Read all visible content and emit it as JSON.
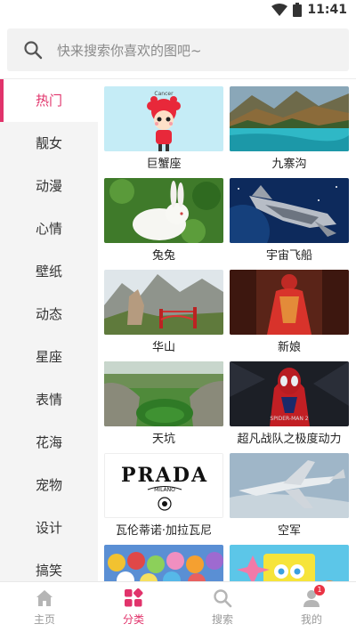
{
  "status_bar": {
    "time": "11:41"
  },
  "search": {
    "placeholder": "快来搜索你喜欢的图吧~"
  },
  "sidebar": {
    "items": [
      {
        "label": "热门",
        "active": true
      },
      {
        "label": "靓女"
      },
      {
        "label": "动漫"
      },
      {
        "label": "心情"
      },
      {
        "label": "壁纸"
      },
      {
        "label": "动态"
      },
      {
        "label": "星座"
      },
      {
        "label": "表情"
      },
      {
        "label": "花海"
      },
      {
        "label": "宠物"
      },
      {
        "label": "设计"
      },
      {
        "label": "搞笑"
      }
    ]
  },
  "grid": {
    "items": [
      {
        "caption": "巨蟹座",
        "art": "cancer-cartoon",
        "art_text": "Cancer"
      },
      {
        "caption": "九寨沟",
        "art": "lake-landscape"
      },
      {
        "caption": "兔兔",
        "art": "white-rabbit"
      },
      {
        "caption": "宇宙飞船",
        "art": "spaceship"
      },
      {
        "caption": "华山",
        "art": "mountain-rock"
      },
      {
        "caption": "新娘",
        "art": "bride-red-dress"
      },
      {
        "caption": "天坑",
        "art": "sinkhole"
      },
      {
        "caption": "超凡战队之极度动力",
        "art": "spider-man",
        "art_text": "SPIDER-MAN 2"
      },
      {
        "caption": "瓦伦蒂诺·加拉瓦尼",
        "art": "prada-logo",
        "art_text": "PRADA",
        "art_subtext": "MILANO"
      },
      {
        "caption": "空军",
        "art": "fighter-jet"
      },
      {
        "caption": "",
        "art": "cartoon-crowd"
      },
      {
        "caption": "",
        "art": "spongebob"
      }
    ]
  },
  "bottom_nav": {
    "items": [
      {
        "label": "主页",
        "icon": "home-icon"
      },
      {
        "label": "分类",
        "icon": "category-icon",
        "active": true
      },
      {
        "label": "搜索",
        "icon": "search-icon"
      },
      {
        "label": "我的",
        "icon": "profile-icon",
        "badge": "1"
      }
    ]
  },
  "colors": {
    "accent": "#e1336b",
    "badge": "#ea3344"
  }
}
